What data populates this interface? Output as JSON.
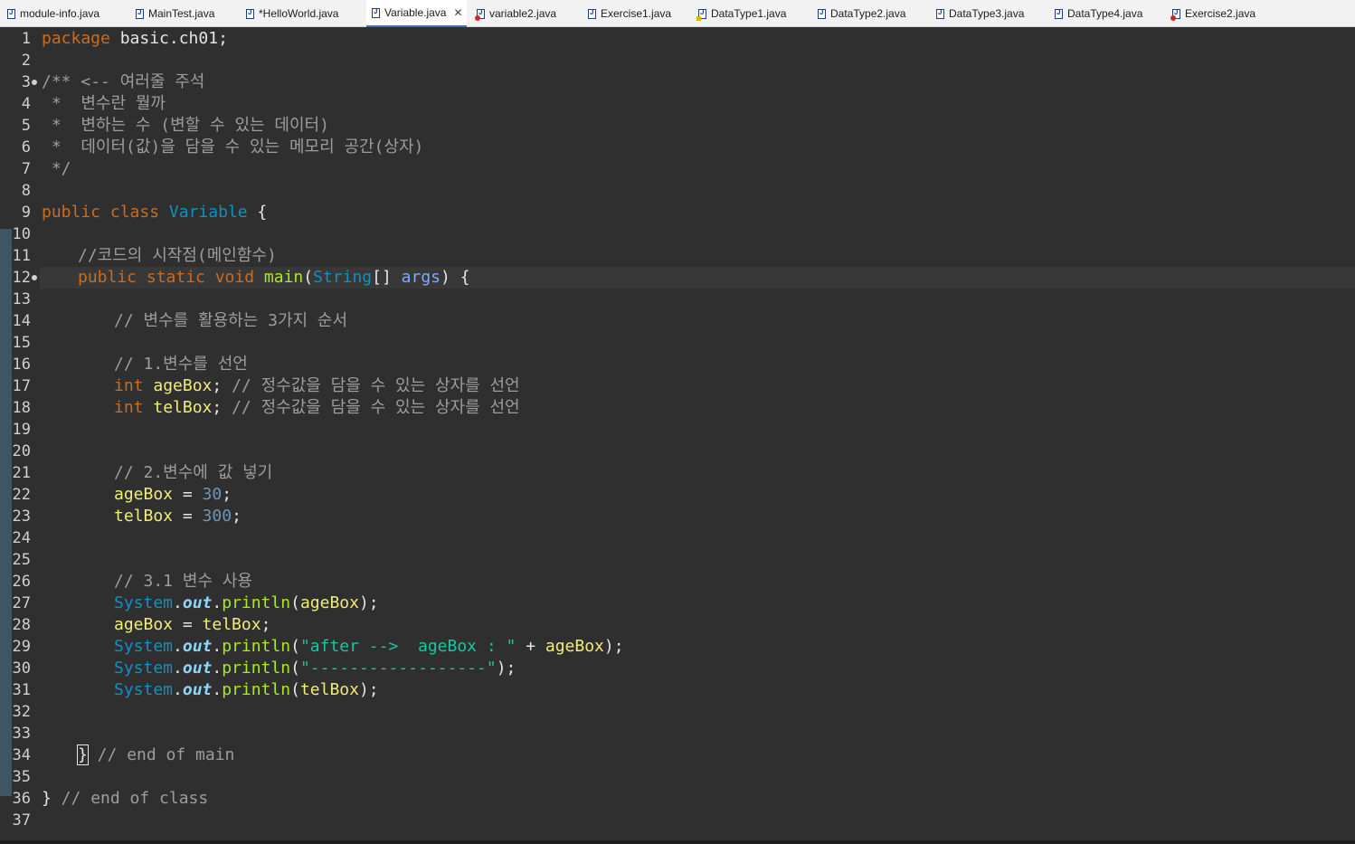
{
  "tabs": [
    {
      "label": "module-info.java",
      "icon": "java-file-icon",
      "state": "normal"
    },
    {
      "label": "MainTest.java",
      "icon": "java-file-icon",
      "state": "normal"
    },
    {
      "label": "*HelloWorld.java",
      "icon": "java-file-icon",
      "state": "normal"
    },
    {
      "label": "Variable.java",
      "icon": "java-file-icon",
      "state": "active",
      "close": "✕"
    },
    {
      "label": "variable2.java",
      "icon": "java-file-icon",
      "state": "error"
    },
    {
      "label": "Exercise1.java",
      "icon": "java-file-icon",
      "state": "normal"
    },
    {
      "label": "DataType1.java",
      "icon": "java-file-icon",
      "state": "warning"
    },
    {
      "label": "DataType2.java",
      "icon": "java-file-icon",
      "state": "normal"
    },
    {
      "label": "DataType3.java",
      "icon": "java-file-icon",
      "state": "normal"
    },
    {
      "label": "DataType4.java",
      "icon": "java-file-icon",
      "state": "normal"
    },
    {
      "label": "Exercise2.java",
      "icon": "java-file-icon",
      "state": "error"
    }
  ],
  "editor": {
    "line_numbers": [
      "1",
      "2",
      "3",
      "4",
      "5",
      "6",
      "7",
      "8",
      "9",
      "10",
      "11",
      "12",
      "13",
      "14",
      "15",
      "16",
      "17",
      "18",
      "19",
      "20",
      "21",
      "22",
      "23",
      "24",
      "25",
      "26",
      "27",
      "28",
      "29",
      "30",
      "31",
      "32",
      "33",
      "34",
      "35",
      "36",
      "37"
    ],
    "code": {
      "l1_kw": "package",
      "l1_rest": " basic.ch01;",
      "l3": "/** <-- 여러줄 주석",
      "l4": " *  변수란 뭘까",
      "l5": " *  변하는 수 (변할 수 있는 데이터)",
      "l6": " *  데이터(값)을 담을 수 있는 메모리 공간(상자)",
      "l7": " */",
      "l9_kw": "public class",
      "l9_cls": "Variable",
      "l9_rest": " {",
      "l11": "//코드의 시작점(메인함수)",
      "l12_kw": "public static void",
      "l12_fn": "main",
      "l12_p1": "(",
      "l12_type": "String",
      "l12_p2": "[] ",
      "l12_arg": "args",
      "l12_p3": ") {",
      "l14": "// 변수를 활용하는 3가지 순서",
      "l16": "// 1.변수를 선언",
      "l17_kw": "int",
      "l17_var": "ageBox",
      "l17_semi": ";",
      "l17_cmt": " // 정수값을 담을 수 있는 상자를 선언",
      "l18_kw": "int",
      "l18_var": "telBox",
      "l18_semi": ";",
      "l18_cmt": " // 정수값을 담을 수 있는 상자를 선언",
      "l21": "// 2.변수에 값 넣기",
      "l22_var": "ageBox",
      "l22_eq": " = ",
      "l22_num": "30",
      "l22_semi": ";",
      "l23_var": "telBox",
      "l23_eq": " = ",
      "l23_num": "300",
      "l23_semi": ";",
      "l26": "// 3.1 변수 사용",
      "sys": "System",
      "dot": ".",
      "out": "out",
      "println": "println",
      "l27_open": "(",
      "l27_var": "ageBox",
      "l27_close": ");",
      "l28_var1": "ageBox",
      "l28_eq": " = ",
      "l28_var2": "telBox",
      "l28_semi": ";",
      "l29_open": "(",
      "l29_str": "\"after -->  ageBox : \"",
      "l29_plus": " + ",
      "l29_var": "ageBox",
      "l29_close": ");",
      "l30_open": "(",
      "l30_str": "\"------------------\"",
      "l30_close": ");",
      "l31_open": "(",
      "l31_var": "telBox",
      "l31_close": ");",
      "l34_brace": "}",
      "l34_cmt": " // end of main",
      "l36_brace": "}",
      "l36_cmt": " // end of class"
    }
  },
  "colors": {
    "background": "#2f2f2f",
    "keyword": "#cc6c1d",
    "class": "#1290c3",
    "comment": "#9d9d9d",
    "variable": "#f3ec79",
    "number": "#6897bb",
    "string": "#17c6a3",
    "static_field": "#8dd6f9",
    "method": "#a7ec21",
    "parameter": "#79abff"
  }
}
